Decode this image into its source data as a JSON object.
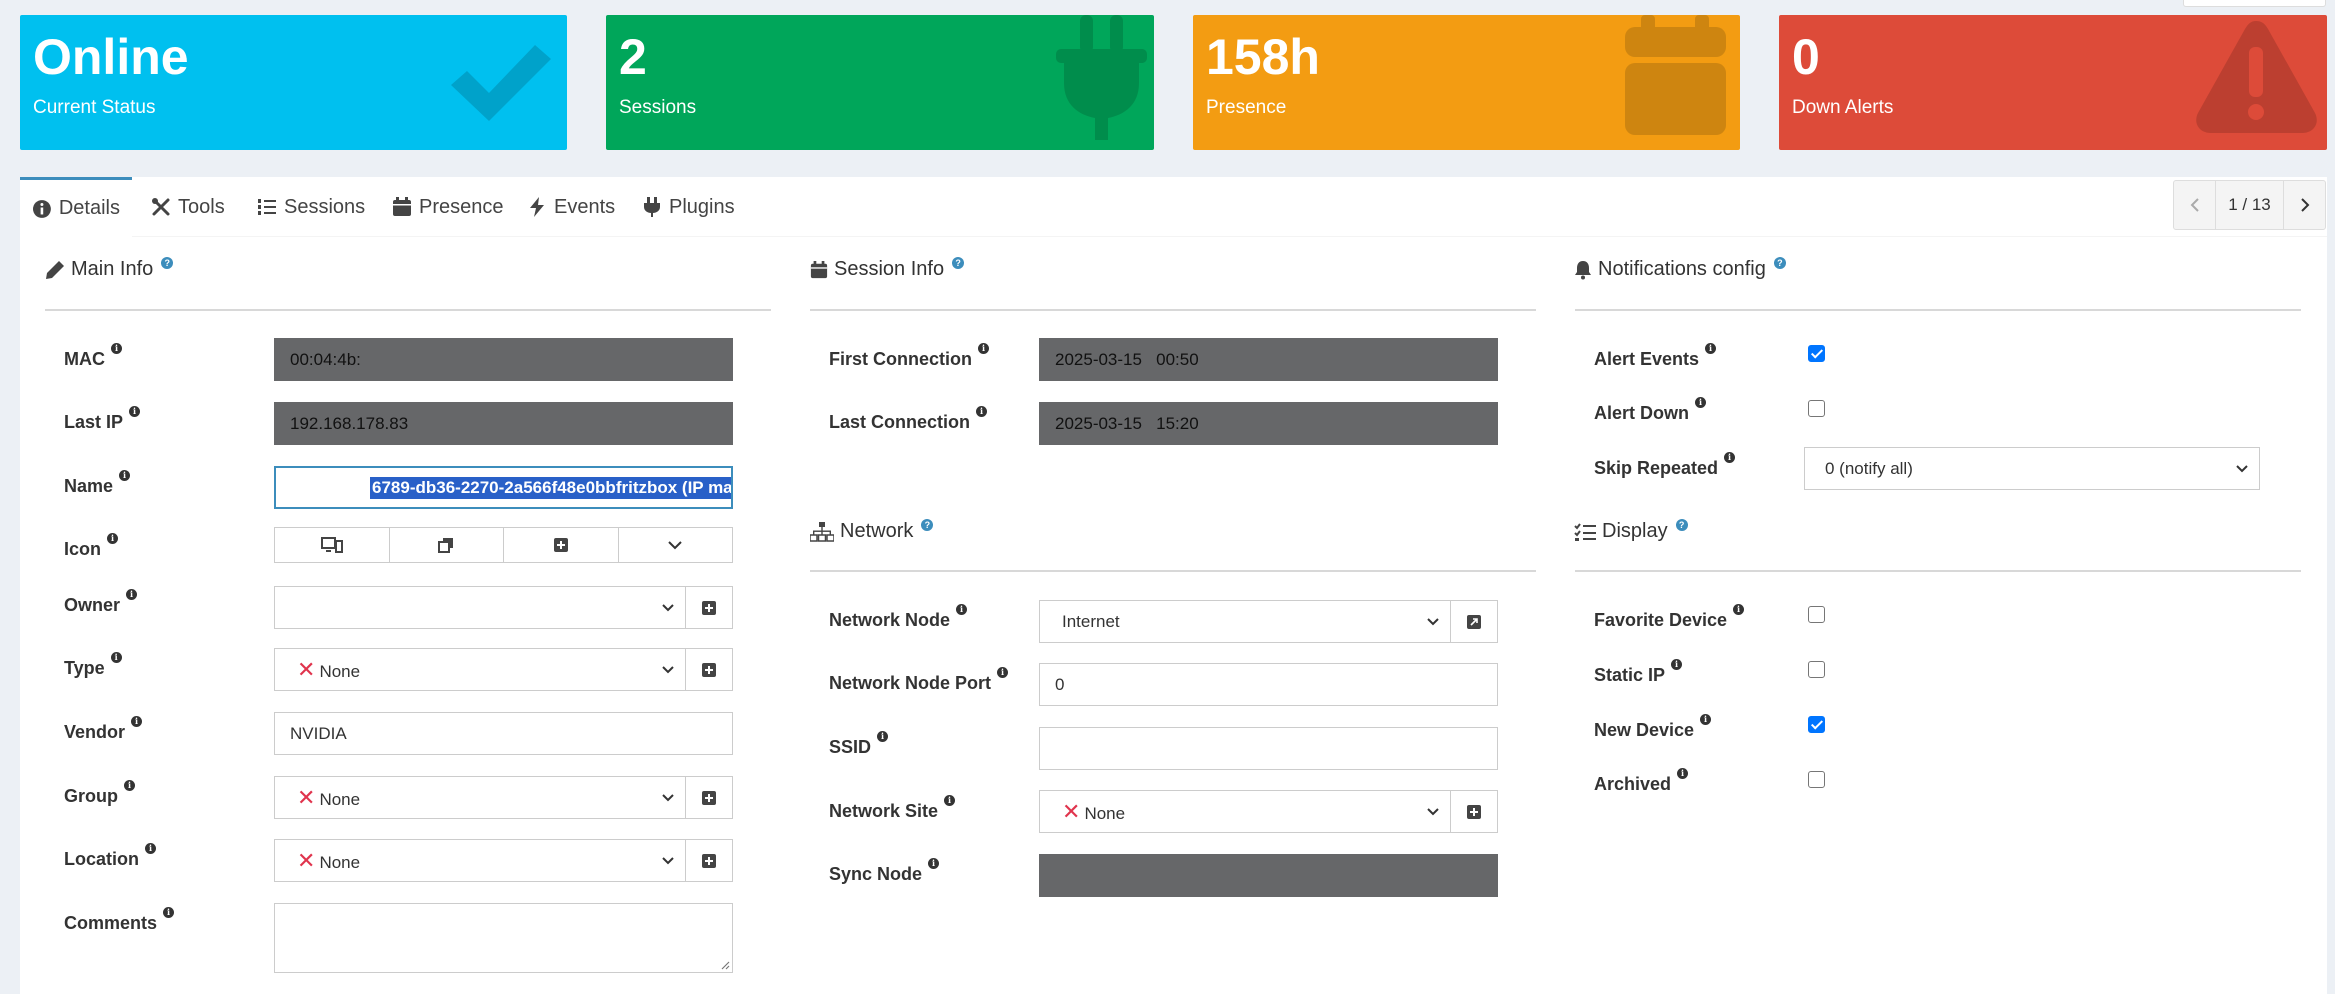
{
  "stats": [
    {
      "value": "Online",
      "label": "Current Status",
      "icon": "check-icon",
      "color": "#00c0ef"
    },
    {
      "value": "2",
      "label": "Sessions",
      "icon": "plug-icon",
      "color": "#00a65a"
    },
    {
      "value": "158h",
      "label": "Presence",
      "icon": "calendar-icon",
      "color": "#f39c12"
    },
    {
      "value": "0",
      "label": "Down Alerts",
      "icon": "warning-icon",
      "color": "#dd4b39"
    }
  ],
  "tabs": [
    {
      "label": "Details",
      "icon": "info-circle-icon",
      "active": true
    },
    {
      "label": "Tools",
      "icon": "tools-icon"
    },
    {
      "label": "Sessions",
      "icon": "list-ol-icon"
    },
    {
      "label": "Presence",
      "icon": "calendar-icon"
    },
    {
      "label": "Events",
      "icon": "bolt-icon"
    },
    {
      "label": "Plugins",
      "icon": "plug-icon"
    }
  ],
  "pager": {
    "text": "1 / 13"
  },
  "main_info": {
    "title": "Main Info",
    "mac": {
      "label": "MAC",
      "value": "00:04:4b:"
    },
    "last_ip": {
      "label": "Last IP",
      "value": "192.168.178.83"
    },
    "name": {
      "label": "Name",
      "value": "6789-db36-2270-2a566f48e0bbfritzbox (IP ma"
    },
    "icon": {
      "label": "Icon"
    },
    "owner": {
      "label": "Owner",
      "value": ""
    },
    "type": {
      "label": "Type",
      "value": "None"
    },
    "vendor": {
      "label": "Vendor",
      "value": "NVIDIA"
    },
    "group": {
      "label": "Group",
      "value": "None"
    },
    "location": {
      "label": "Location",
      "value": "None"
    },
    "comments": {
      "label": "Comments",
      "value": ""
    }
  },
  "session_info": {
    "title": "Session Info",
    "first_connection": {
      "label": "First Connection",
      "value": "2025-03-15   00:50"
    },
    "last_connection": {
      "label": "Last Connection",
      "value": "2025-03-15   15:20"
    }
  },
  "network": {
    "title": "Network",
    "node": {
      "label": "Network Node",
      "value": "Internet"
    },
    "port": {
      "label": "Network Node Port",
      "value": "0"
    },
    "ssid": {
      "label": "SSID",
      "value": ""
    },
    "site": {
      "label": "Network Site",
      "value": "None"
    },
    "sync_node": {
      "label": "Sync Node",
      "value": ""
    }
  },
  "notifications": {
    "title": "Notifications config",
    "alert_events": {
      "label": "Alert Events",
      "checked": true
    },
    "alert_down": {
      "label": "Alert Down",
      "checked": false
    },
    "skip_repeated": {
      "label": "Skip Repeated",
      "value": "0 (notify all)"
    }
  },
  "display": {
    "title": "Display",
    "favorite": {
      "label": "Favorite Device",
      "checked": false
    },
    "static_ip": {
      "label": "Static IP",
      "checked": false
    },
    "new_device": {
      "label": "New Device",
      "checked": true
    },
    "archived": {
      "label": "Archived",
      "checked": false
    }
  }
}
